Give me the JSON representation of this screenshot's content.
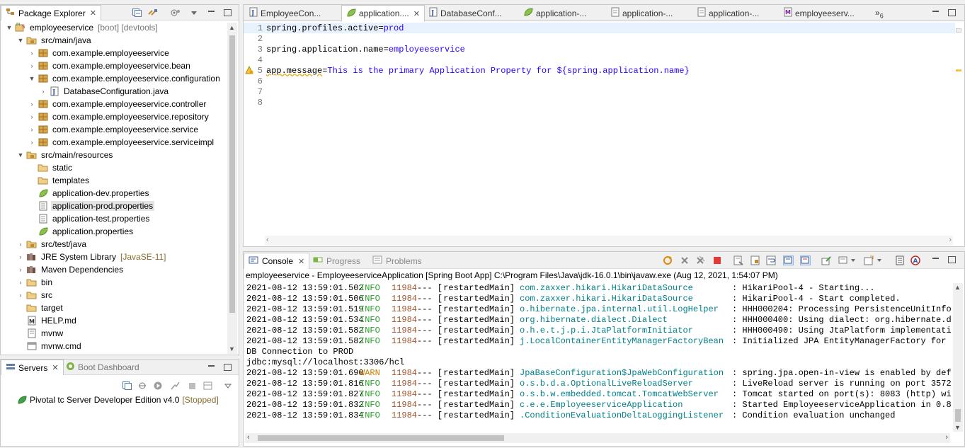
{
  "package_explorer": {
    "tab_label": "Package Explorer",
    "items": [
      {
        "label": "employeeservice",
        "deco": "[boot] [devtools]"
      },
      {
        "label": "src/main/java"
      },
      {
        "label": "com.example.employeeservice"
      },
      {
        "label": "com.example.employeeservice.bean"
      },
      {
        "label": "com.example.employeeservice.configuration"
      },
      {
        "label": "DatabaseConfiguration.java"
      },
      {
        "label": "com.example.employeeservice.controller"
      },
      {
        "label": "com.example.employeeservice.repository"
      },
      {
        "label": "com.example.employeeservice.service"
      },
      {
        "label": "com.example.employeeservice.serviceimpl"
      },
      {
        "label": "src/main/resources"
      },
      {
        "label": "static"
      },
      {
        "label": "templates"
      },
      {
        "label": "application-dev.properties"
      },
      {
        "label": "application-prod.properties"
      },
      {
        "label": "application-test.properties"
      },
      {
        "label": "application.properties"
      },
      {
        "label": "src/test/java"
      },
      {
        "label": "JRE System Library",
        "deco": "[JavaSE-11]"
      },
      {
        "label": "Maven Dependencies"
      },
      {
        "label": "bin"
      },
      {
        "label": "src"
      },
      {
        "label": "target"
      },
      {
        "label": "HELP.md"
      },
      {
        "label": "mvnw"
      },
      {
        "label": "mvnw.cmd"
      }
    ]
  },
  "servers": {
    "tab_label": "Servers",
    "boot_dashboard_label": "Boot Dashboard",
    "server_name": "Pivotal tc Server Developer Edition v4.0",
    "server_status": "[Stopped]"
  },
  "editor": {
    "tabs": [
      "EmployeeCon...",
      "application....",
      "DatabaseConf...",
      "application-...",
      "application-...",
      "application-...",
      "employeeserv..."
    ],
    "overflow_count": "6",
    "lines": [
      {
        "num": "1",
        "key": "spring.profiles.active",
        "eq": "=",
        "value": "prod"
      },
      {
        "num": "2",
        "key": "",
        "eq": "",
        "value": ""
      },
      {
        "num": "3",
        "key": "spring.application.name",
        "eq": "=",
        "value": "employeeservice"
      },
      {
        "num": "4",
        "key": "",
        "eq": "",
        "value": ""
      },
      {
        "num": "5",
        "key": "app.message",
        "eq": "=",
        "value": "This is the primary Application Property for ${spring.application.name}"
      },
      {
        "num": "6",
        "key": "",
        "eq": "",
        "value": ""
      },
      {
        "num": "7",
        "key": "",
        "eq": "",
        "value": ""
      },
      {
        "num": "8",
        "key": "",
        "eq": "",
        "value": ""
      }
    ]
  },
  "console": {
    "tab_label": "Console",
    "progress_label": "Progress",
    "problems_label": "Problems",
    "header": "employeeservice - EmployeeserviceApplication [Spring Boot App] C:\\Program Files\\Java\\jdk-16.0.1\\bin\\javaw.exe  (Aug 12, 2021, 1:54:07 PM)",
    "logs": [
      {
        "ts": "2021-08-12 13:59:01.502",
        "level": "INFO",
        "pid": "11984",
        "sep": "--- [",
        "thread": "restartedMain]",
        "logger": "com.zaxxer.hikari.HikariDataSource",
        "msg": ": HikariPool-4 - Starting..."
      },
      {
        "ts": "2021-08-12 13:59:01.506",
        "level": "INFO",
        "pid": "11984",
        "sep": "--- [",
        "thread": "restartedMain]",
        "logger": "com.zaxxer.hikari.HikariDataSource",
        "msg": ": HikariPool-4 - Start completed."
      },
      {
        "ts": "2021-08-12 13:59:01.519",
        "level": "INFO",
        "pid": "11984",
        "sep": "--- [",
        "thread": "restartedMain]",
        "logger": "o.hibernate.jpa.internal.util.LogHelper",
        "msg": ": HHH000204: Processing PersistenceUnitInfo"
      },
      {
        "ts": "2021-08-12 13:59:01.534",
        "level": "INFO",
        "pid": "11984",
        "sep": "--- [",
        "thread": "restartedMain]",
        "logger": "org.hibernate.dialect.Dialect",
        "msg": ": HHH000400: Using dialect: org.hibernate.d"
      },
      {
        "ts": "2021-08-12 13:59:01.582",
        "level": "INFO",
        "pid": "11984",
        "sep": "--- [",
        "thread": "restartedMain]",
        "logger": "o.h.e.t.j.p.i.JtaPlatformInitiator",
        "msg": ": HHH000490: Using JtaPlatform implementati"
      },
      {
        "ts": "2021-08-12 13:59:01.582",
        "level": "INFO",
        "pid": "11984",
        "sep": "--- [",
        "thread": "restartedMain]",
        "logger": "j.LocalContainerEntityManagerFactoryBean",
        "msg": ": Initialized JPA EntityManagerFactory for"
      },
      {
        "plain": "DB Connection to PROD"
      },
      {
        "plain": "jdbc:mysql://localhost:3306/hcl"
      },
      {
        "ts": "2021-08-12 13:59:01.690",
        "level": "WARN",
        "pid": "11984",
        "sep": "--- [",
        "thread": "restartedMain]",
        "logger": "JpaBaseConfiguration$JpaWebConfiguration",
        "msg": ": spring.jpa.open-in-view is enabled by def"
      },
      {
        "ts": "2021-08-12 13:59:01.816",
        "level": "INFO",
        "pid": "11984",
        "sep": "--- [",
        "thread": "restartedMain]",
        "logger": "o.s.b.d.a.OptionalLiveReloadServer",
        "msg": ": LiveReload server is running on port 3572"
      },
      {
        "ts": "2021-08-12 13:59:01.827",
        "level": "INFO",
        "pid": "11984",
        "sep": "--- [",
        "thread": "restartedMain]",
        "logger": "o.s.b.w.embedded.tomcat.TomcatWebServer",
        "msg": ": Tomcat started on port(s): 8083 (http) wi"
      },
      {
        "ts": "2021-08-12 13:59:01.832",
        "level": "INFO",
        "pid": "11984",
        "sep": "--- [",
        "thread": "restartedMain]",
        "logger": "c.e.e.EmployeeserviceApplication",
        "msg": ": Started EmployeeserviceApplication in 0.8"
      },
      {
        "ts": "2021-08-12 13:59:01.834",
        "level": "INFO",
        "pid": "11984",
        "sep": "--- [",
        "thread": "restartedMain]",
        "logger": ".ConditionEvaluationDeltaLoggingListener",
        "msg": ": Condition evaluation unchanged"
      }
    ]
  }
}
